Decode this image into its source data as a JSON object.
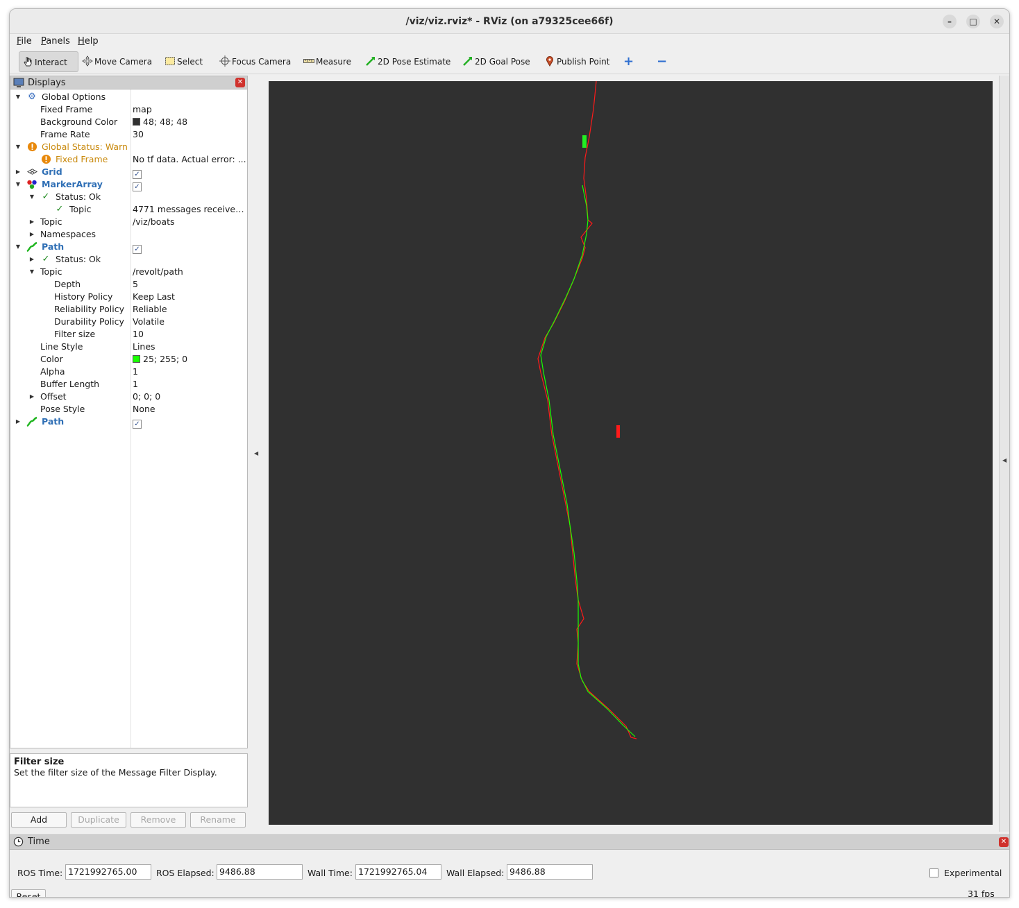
{
  "window": {
    "title": "/viz/viz.rviz* - RViz (on a79325cee66f)",
    "controls": {
      "minimize": "–",
      "maximize": "□",
      "close": "✕"
    }
  },
  "menu": [
    "File",
    "Panels",
    "Help"
  ],
  "toolbar": {
    "interact": "Interact",
    "move_camera": "Move Camera",
    "select": "Select",
    "focus_camera": "Focus Camera",
    "measure": "Measure",
    "pose_estimate": "2D Pose Estimate",
    "goal_pose": "2D Goal Pose",
    "publish_point": "Publish Point",
    "add_tool": "+",
    "remove_tool": "−"
  },
  "displays": {
    "title": "Displays",
    "rows": [
      {
        "label": "Global Options",
        "value": ""
      },
      {
        "label": "Fixed Frame",
        "value": "map"
      },
      {
        "label": "Background Color",
        "value": "48; 48; 48"
      },
      {
        "label": "Frame Rate",
        "value": "30"
      },
      {
        "label": "Global Status: Warn",
        "value": ""
      },
      {
        "label": "Fixed Frame",
        "value": "No tf data.  Actual error: ..."
      },
      {
        "label": "Grid",
        "value": "✓"
      },
      {
        "label": "MarkerArray",
        "value": "✓"
      },
      {
        "label": "Status: Ok",
        "value": ""
      },
      {
        "label": "Topic",
        "value": "4771 messages received..."
      },
      {
        "label": "Topic",
        "value": "/viz/boats"
      },
      {
        "label": "Namespaces",
        "value": ""
      },
      {
        "label": "Path",
        "value": "✓"
      },
      {
        "label": "Status: Ok",
        "value": ""
      },
      {
        "label": "Topic",
        "value": "/revolt/path"
      },
      {
        "label": "Depth",
        "value": "5"
      },
      {
        "label": "History Policy",
        "value": "Keep Last"
      },
      {
        "label": "Reliability Policy",
        "value": "Reliable"
      },
      {
        "label": "Durability Policy",
        "value": "Volatile"
      },
      {
        "label": "Filter size",
        "value": "10"
      },
      {
        "label": "Line Style",
        "value": "Lines"
      },
      {
        "label": "Color",
        "value": "25; 255; 0"
      },
      {
        "label": "Alpha",
        "value": "1"
      },
      {
        "label": "Buffer Length",
        "value": "1"
      },
      {
        "label": "Offset",
        "value": "0; 0; 0"
      },
      {
        "label": "Pose Style",
        "value": "None"
      },
      {
        "label": "Path",
        "value": "✓"
      }
    ],
    "colors": {
      "background": "#303030",
      "path": "#19ff00",
      "warn": "#e8890c"
    }
  },
  "description": {
    "title": "Filter size",
    "text": "Set the filter size of the Message Filter Display."
  },
  "panel_buttons": {
    "add": "Add",
    "duplicate": "Duplicate",
    "remove": "Remove",
    "rename": "Rename"
  },
  "time": {
    "title": "Time",
    "ros_time_label": "ROS Time:",
    "ros_time": "1721992765.00",
    "ros_elapsed_label": "ROS Elapsed:",
    "ros_elapsed": "9486.88",
    "wall_time_label": "Wall Time:",
    "wall_time": "1721992765.04",
    "wall_elapsed_label": "Wall Elapsed:",
    "wall_elapsed": "9486.88",
    "experimental": "Experimental",
    "reset": "Reset",
    "fps": "31 fps"
  }
}
